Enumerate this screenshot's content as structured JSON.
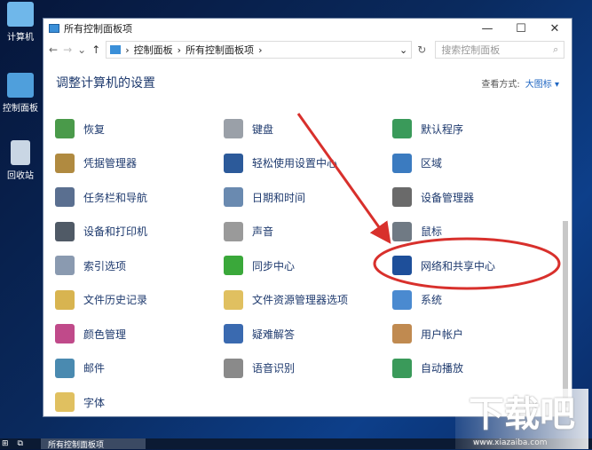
{
  "desktop": [
    {
      "label": "计算机",
      "color": "#6fb7ea"
    },
    {
      "label": "控制面板",
      "color": "#4f9fdc"
    },
    {
      "label": "回收站",
      "color": "#c9d6e4"
    }
  ],
  "window": {
    "title": "所有控制面板项",
    "minimize": "—",
    "maximize": "☐",
    "close": "✕"
  },
  "address": {
    "back": "←",
    "forward": "→",
    "recent": "⌄",
    "up": "↑",
    "crumbs": [
      "控制面板",
      "所有控制面板项"
    ],
    "sep": "›",
    "dropdown": "⌄",
    "refresh": "↻",
    "search_placeholder": "搜索控制面板",
    "search_icon": "⌕"
  },
  "header": {
    "title": "调整计算机的设置",
    "view_label": "查看方式:",
    "view_value": "大图标 ▾"
  },
  "items": [
    {
      "label": "恢复",
      "color": "#4a9a4a"
    },
    {
      "label": "键盘",
      "color": "#9aa0a8"
    },
    {
      "label": "默认程序",
      "color": "#3a9a5a"
    },
    {
      "label": "凭据管理器",
      "color": "#b08a40"
    },
    {
      "label": "轻松使用设置中心",
      "color": "#2c5a9a"
    },
    {
      "label": "区域",
      "color": "#3b7bc0"
    },
    {
      "label": "任务栏和导航",
      "color": "#5a6f90"
    },
    {
      "label": "日期和时间",
      "color": "#6a8ab0"
    },
    {
      "label": "设备管理器",
      "color": "#6a6a6a"
    },
    {
      "label": "设备和打印机",
      "color": "#505a66"
    },
    {
      "label": "声音",
      "color": "#9a9a9a"
    },
    {
      "label": "鼠标",
      "color": "#707a84"
    },
    {
      "label": "索引选项",
      "color": "#8a9ab0"
    },
    {
      "label": "同步中心",
      "color": "#3aa83a"
    },
    {
      "label": "网络和共享中心",
      "color": "#1e4f9a"
    },
    {
      "label": "文件历史记录",
      "color": "#d8b450"
    },
    {
      "label": "文件资源管理器选项",
      "color": "#e0c060"
    },
    {
      "label": "系统",
      "color": "#4a8ad0"
    },
    {
      "label": "颜色管理",
      "color": "#c04a8a"
    },
    {
      "label": "疑难解答",
      "color": "#3a6ab0"
    },
    {
      "label": "用户帐户",
      "color": "#c08a50"
    },
    {
      "label": "邮件",
      "color": "#4a8ab0"
    },
    {
      "label": "语音识别",
      "color": "#8a8a8a"
    },
    {
      "label": "自动播放",
      "color": "#3a9a5a"
    },
    {
      "label": "字体",
      "color": "#e0c060"
    }
  ],
  "taskbar": {
    "app": "所有控制面板项"
  },
  "watermark": {
    "text": "下载吧",
    "url": "www.xiazaiba.com"
  },
  "annotation_color": "#d8302c"
}
